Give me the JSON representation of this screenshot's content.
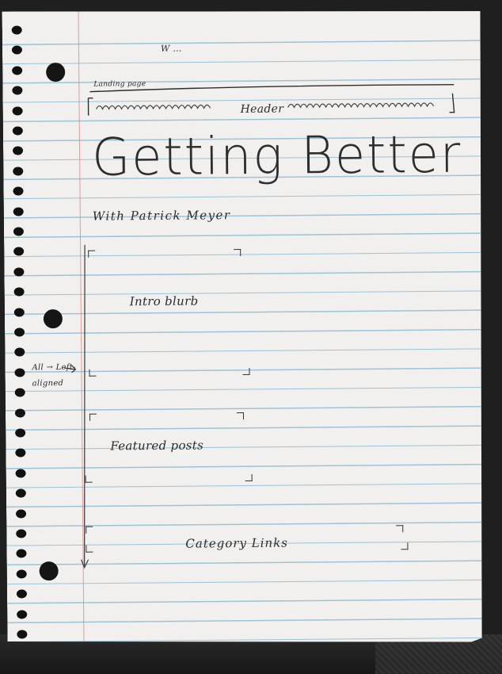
{
  "notebook": {
    "top_note": "W …",
    "page_label": "Landing page",
    "header_label": "Header",
    "title": "Getting Better",
    "subtitle": "With Patrick Meyer",
    "side_note": "All → Left-aligned",
    "sections": [
      {
        "label": "Intro blurb"
      },
      {
        "label": "Featured posts"
      },
      {
        "label": "Category Links"
      }
    ]
  },
  "colors": {
    "paper": "#f1f0ee",
    "rule_line": "#9cc3d6",
    "margin_line": "#d98a8a",
    "pencil": "#2b2b2b"
  }
}
